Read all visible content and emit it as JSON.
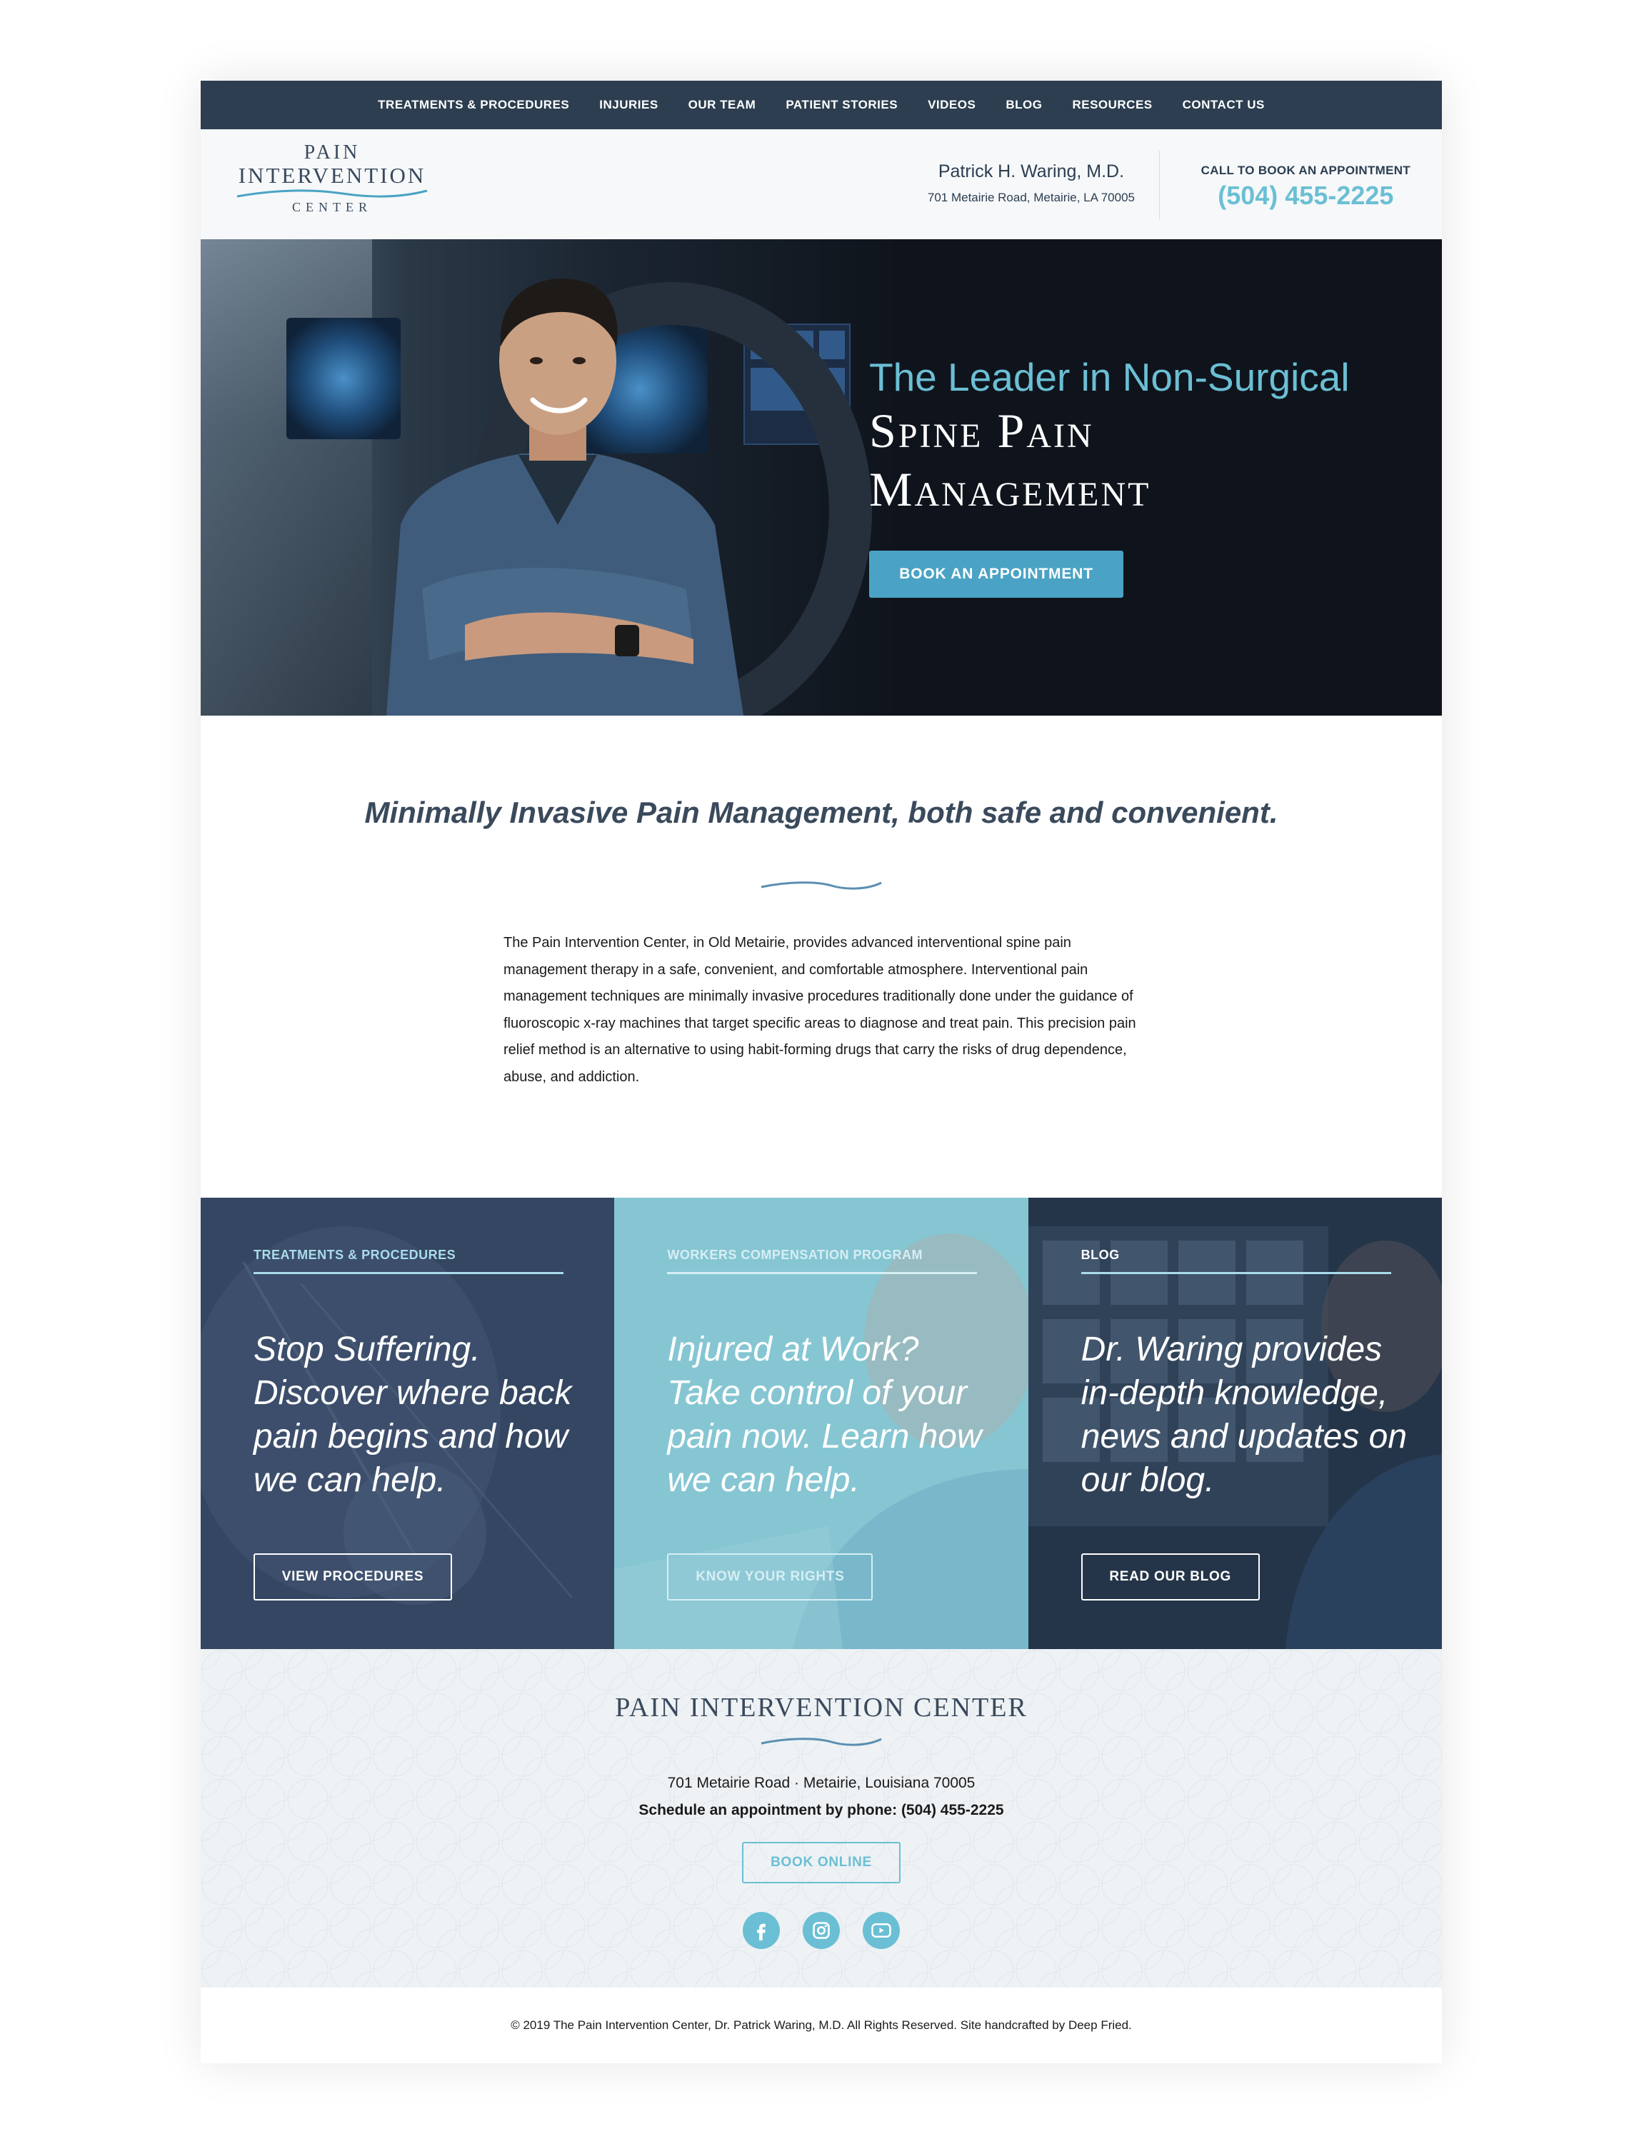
{
  "nav": {
    "items": [
      "TREATMENTS & PROCEDURES",
      "INJURIES",
      "OUR TEAM",
      "PATIENT STORIES",
      "VIDEOS",
      "BLOG",
      "RESOURCES",
      "CONTACT US"
    ]
  },
  "header": {
    "logo": {
      "line1": "PAIN",
      "line2": "INTERVENTION",
      "line3": "CENTER"
    },
    "doctor_name": "Patrick H. Waring, M.D.",
    "address": "701 Metairie Road, Metairie, LA 70005",
    "call_label": "CALL TO BOOK AN APPOINTMENT",
    "phone": "(504) 455-2225"
  },
  "hero": {
    "title_line1": "The Leader in Non-Surgical",
    "title_line2": "Spine Pain",
    "title_line3": "Management",
    "button_label": "BOOK AN APPOINTMENT"
  },
  "intro": {
    "tagline": "Minimally Invasive Pain Management, both safe and convenient.",
    "body": "The Pain Intervention Center, in Old Metairie, provides advanced interventional spine pain management therapy in a safe, convenient, and comfortable atmosphere. Interventional pain management techniques are minimally invasive procedures traditionally done under the guidance of fluoroscopic x-ray machines that target specific areas to diagnose and treat pain. This precision pain relief method is an alternative to using habit-forming drugs that carry the risks of drug dependence, abuse, and addiction."
  },
  "cards": [
    {
      "eyebrow": "TREATMENTS & PROCEDURES",
      "heading": "Stop Suffering. Discover where back pain begins and how we can help.",
      "cta": "VIEW PROCEDURES"
    },
    {
      "eyebrow": "WORKERS COMPENSATION PROGRAM",
      "heading": "Injured at Work? Take control of your pain now. Learn how we can help.",
      "cta": "KNOW YOUR RIGHTS"
    },
    {
      "eyebrow": "BLOG",
      "heading": "Dr. Waring provides in-depth knowledge, news and updates on our blog.",
      "cta": "READ OUR BLOG"
    }
  ],
  "footer": {
    "brand": "PAIN INTERVENTION CENTER",
    "address": "701 Metairie Road · Metairie, Louisiana 70005",
    "schedule": "Schedule an appointment by phone: (504) 455-2225",
    "button_label": "BOOK ONLINE",
    "social": [
      "facebook-icon",
      "instagram-icon",
      "youtube-icon"
    ]
  },
  "copyright": "© 2019 The Pain Intervention Center, Dr. Patrick Waring, M.D. All Rights Reserved. Site handcrafted by Deep Fried.",
  "colors": {
    "navy": "#2c3e50",
    "accent": "#6bbfd4",
    "button": "#4aa3c4",
    "card1": "#3a4e6e",
    "card2": "#7fc3d2",
    "card3": "#2c3e56"
  }
}
